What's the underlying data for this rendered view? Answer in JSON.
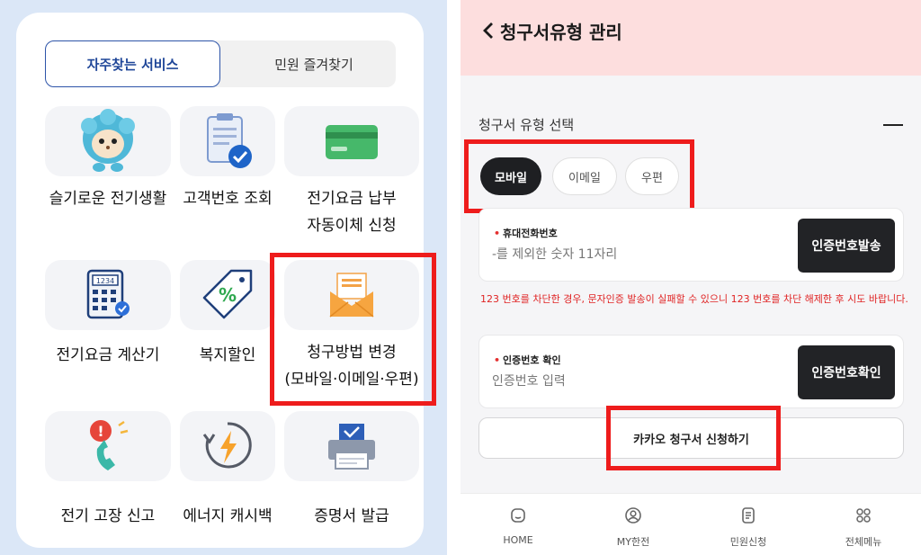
{
  "left": {
    "tabs": {
      "active": "자주찾는 서비스",
      "inactive": "민원 즐겨찾기"
    },
    "services": [
      {
        "icon": "hedgehog-mascot-icon",
        "label": "슬기로운 전기생활"
      },
      {
        "icon": "clipboard-check-icon",
        "label": "고객번호 조회"
      },
      {
        "icon": "credit-card-icon",
        "label_line1": "전기요금 납부",
        "label_line2": "자동이체 신청"
      },
      {
        "icon": "calculator-icon",
        "label": "전기요금 계산기",
        "calc_display": "1234"
      },
      {
        "icon": "discount-tag-icon",
        "label": "복지할인",
        "tag_symbol": "%"
      },
      {
        "icon": "envelope-icon",
        "label_line1": "청구방법 변경",
        "label_line2": "(모바일·이메일·우편)"
      },
      {
        "icon": "phone-alert-icon",
        "label": "전기 고장 신고",
        "alert_symbol": "!"
      },
      {
        "icon": "energy-cashback-icon",
        "label": "에너지 캐시백"
      },
      {
        "icon": "printer-icon",
        "label": "증명서 발급"
      }
    ]
  },
  "right": {
    "header_title": "청구서유형 관리",
    "section_label": "청구서 유형 선택",
    "bill_types": [
      "모바일",
      "이메일",
      "우편"
    ],
    "phone_field": {
      "label": "휴대전화번호",
      "placeholder": "-를 제외한 숫자 11자리",
      "button": "인증번호발송"
    },
    "warning": "123 번호를 차단한 경우, 문자인증 발송이 실패할 수 있으니 123 번호를 차단 해제한 후 시도 바랍니다.",
    "code_field": {
      "label": "인증번호 확인",
      "placeholder": "인증번호 입력",
      "button": "인증번호확인"
    },
    "kakao_button": "카카오 청구서 신청하기",
    "bottom_nav": [
      {
        "icon": "home-icon",
        "label": "HOME"
      },
      {
        "icon": "user-icon",
        "label": "MY한전"
      },
      {
        "icon": "document-icon",
        "label": "민원신청"
      },
      {
        "icon": "grid-menu-icon",
        "label": "전체메뉴"
      }
    ]
  },
  "colors": {
    "highlight": "#ee1c1c",
    "accent_blue": "#2d54a8",
    "header_pink": "#fddede",
    "warning_red": "#e02424",
    "dark_button": "#222326"
  }
}
